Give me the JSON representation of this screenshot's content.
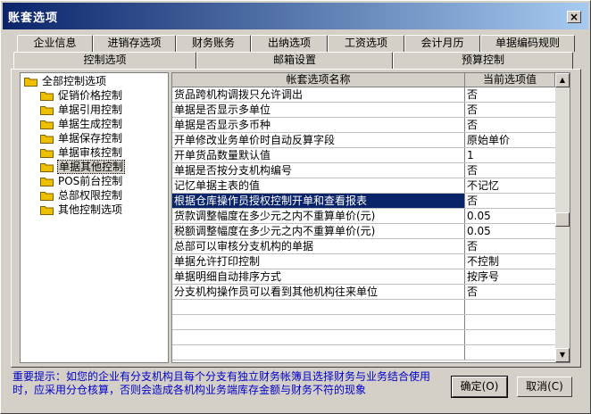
{
  "window": {
    "title": "账套选项",
    "close_glyph": "×"
  },
  "tabs_row1": [
    "企业信息",
    "进销存选项",
    "财务账务",
    "出纳选项",
    "工资选项",
    "会计月历",
    "单据编码规则"
  ],
  "tabs_row2": [
    "控制选项",
    "邮箱设置",
    "预算控制"
  ],
  "tree": {
    "root": "全部控制选项",
    "children": [
      "促销价格控制",
      "单据引用控制",
      "单据生成控制",
      "单据保存控制",
      "单据审核控制",
      "单据其他控制",
      "POS前台控制",
      "总部权限控制",
      "其他控制选项"
    ],
    "selected": "单据其他控制"
  },
  "grid": {
    "headers": [
      "帐套选项名称",
      "当前选项值"
    ],
    "rows": [
      [
        "货品跨机构调拨只允许调出",
        "否"
      ],
      [
        "单据是否显示多单位",
        "否"
      ],
      [
        "单据是否显示多币种",
        "否"
      ],
      [
        "开单修改业务单价时自动反算字段",
        "原始单价"
      ],
      [
        "开单货品数量默认值",
        "1"
      ],
      [
        "单据是否按分支机构编号",
        "否"
      ],
      [
        "记忆单据主表的值",
        "不记忆"
      ],
      [
        "根据仓库操作员授权控制开单和查看报表",
        "否"
      ],
      [
        "货款调整幅度在多少元之内不重算单价(元)",
        "0.05"
      ],
      [
        "税额调整幅度在多少元之内不重算单价(元)",
        "0.05"
      ],
      [
        "总部可以审核分支机构的单据",
        "否"
      ],
      [
        "单据允许打印控制",
        "不控制"
      ],
      [
        "单据明细自动排序方式",
        "按序号"
      ],
      [
        "分支机构操作员可以看到其他机构往来单位",
        "否"
      ]
    ],
    "selected_row": 7
  },
  "hint": "重要提示：如您的企业有分支机构且每个分支有独立财务帐簿且选择财务与业务结合使用时，应采用分仓核算，否则会造成各机构业务端库存金额与财务不符的现象",
  "buttons": {
    "ok": "确定(O)",
    "cancel": "取消(C)"
  },
  "colors": {
    "titlebar": "#0a246a",
    "selection": "#0a246a",
    "hint": "#0000c8",
    "folder": "#f0c000"
  }
}
